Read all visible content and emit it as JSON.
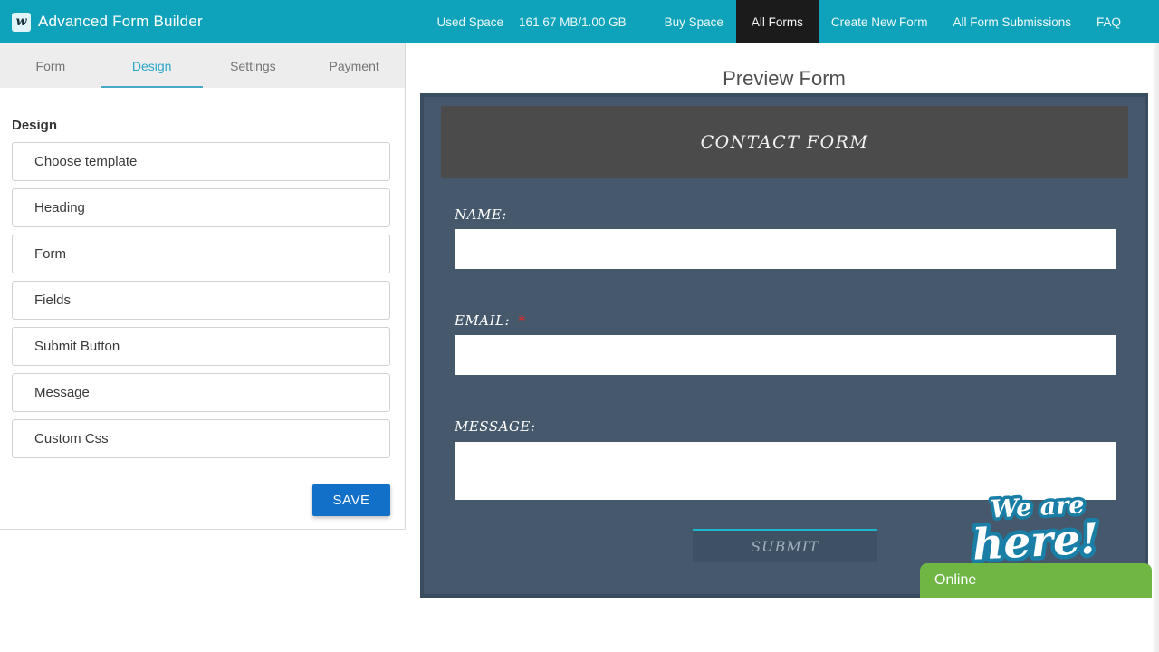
{
  "topbar": {
    "logo_letter": "w",
    "title": "Advanced Form Builder",
    "used_space": {
      "label": "Used Space",
      "value": "161.67 MB/1.00 GB"
    },
    "links": [
      "Buy Space",
      "All Forms",
      "Create New Form",
      "All Form Submissions",
      "FAQ"
    ],
    "active_link": "All Forms"
  },
  "builder_panel": {
    "tabs": [
      {
        "label": "Form",
        "active": false
      },
      {
        "label": "Design",
        "active": true
      },
      {
        "label": "Settings",
        "active": false
      },
      {
        "label": "Payment",
        "active": false
      }
    ],
    "section_title": "Design",
    "accordion_items": [
      "Choose template",
      "Heading",
      "Form",
      "Fields",
      "Submit Button",
      "Message",
      "Custom Css"
    ],
    "save_label": "SAVE"
  },
  "preview": {
    "title": "Preview Form",
    "form": {
      "heading": "CONTACT FORM",
      "required_marker": "*",
      "fields": [
        {
          "label": "NAME:",
          "type": "text",
          "required": false,
          "value": ""
        },
        {
          "label": "EMAIL:",
          "type": "text",
          "required": true,
          "value": ""
        },
        {
          "label": "MESSAGE:",
          "type": "textarea",
          "required": false,
          "value": ""
        }
      ],
      "submit_label": "SUBMIT"
    }
  },
  "chat_widget": {
    "sticker_line1": "We are",
    "sticker_line2": "here!",
    "status": "Online"
  },
  "colors": {
    "topbar_teal": "#0EA3BA",
    "active_nav_black": "#1B1B1B",
    "tab_active_teal": "#2AA6C8",
    "save_button_blue": "#1270C8",
    "form_background": "#46586B",
    "form_border": "#3A4D60",
    "form_header_gray": "#4B4B4B",
    "submit_accent_cyan": "#1CB9CC",
    "required_red": "#E02B2B",
    "online_green": "#6FB645",
    "sticker_outline_teal": "#1A7FA6"
  }
}
